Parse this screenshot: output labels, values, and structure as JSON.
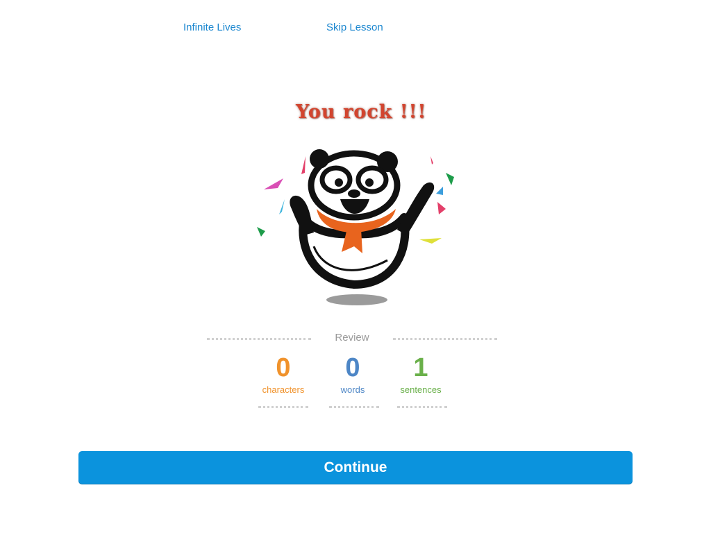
{
  "top_links": {
    "infinite_lives": "Infinite Lives",
    "skip_lesson": "Skip Lesson"
  },
  "celebration": {
    "headline": "You rock !!!"
  },
  "review": {
    "label": "Review",
    "stats": [
      {
        "value": "0",
        "label": "characters",
        "color": "#f0922b"
      },
      {
        "value": "0",
        "label": "words",
        "color": "#4d86c6"
      },
      {
        "value": "1",
        "label": "sentences",
        "color": "#6ab04a"
      }
    ]
  },
  "actions": {
    "continue_label": "Continue"
  },
  "colors": {
    "link": "#1a86cf",
    "primary_button": "#0b93dd",
    "scarf": "#e8641e"
  }
}
